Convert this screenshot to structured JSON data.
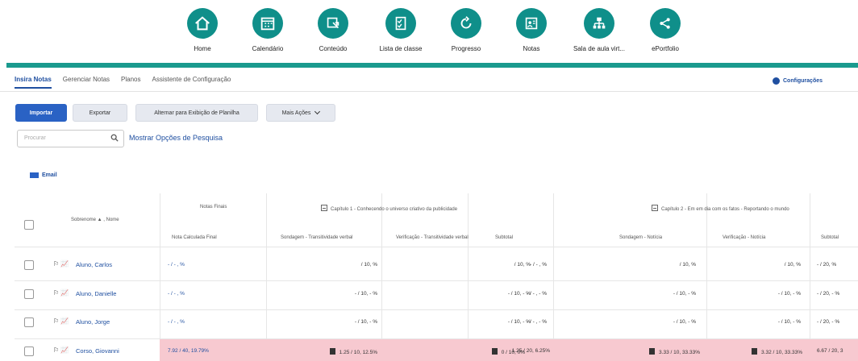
{
  "nav": [
    {
      "label": "Home",
      "icon": "home-icon"
    },
    {
      "label": "Calendário",
      "icon": "calendar-icon"
    },
    {
      "label": "Conteúdo",
      "icon": "content-icon"
    },
    {
      "label": "Lista de classe",
      "icon": "class-list-icon"
    },
    {
      "label": "Progresso",
      "icon": "progress-icon"
    },
    {
      "label": "Notas",
      "icon": "grades-icon"
    },
    {
      "label": "Sala de aula virt...",
      "icon": "virtual-classroom-icon"
    },
    {
      "label": "ePortfolio",
      "icon": "eportfolio-icon"
    }
  ],
  "tabs": [
    "Insira Notas",
    "Gerenciar Notas",
    "Planos",
    "Assistente de Configuração"
  ],
  "config_label": "Configurações",
  "toolbar": {
    "import": "Importar",
    "export": "Exportar",
    "toggle": "Alternar para Exibição de Planilha",
    "more": "Mais Ações"
  },
  "search": {
    "placeholder": "Procurar",
    "options": "Mostrar Opções de Pesquisa"
  },
  "email_label": "Email",
  "grid": {
    "col_name": "Sobrenome ▲ , Nome",
    "col_final": "Notas Finais",
    "col_final_sub": "Nota Calculada Final",
    "chapter1": "Capítulo 1 - Conhecendo o universo criativo da publicidade",
    "chapter2": "Capítulo 2 - Em em dia com os fatos - Reportando o mundo",
    "subcols": [
      "Sondagem - Transitividade verbal",
      "Verificação - Transitividade verbal",
      "Subtotal",
      "Sondagem - Notícia",
      "Verificação - Notícia",
      "Subtotal"
    ],
    "rows": [
      {
        "name": "Aluno, Carlos",
        "final": "- / - , % ",
        "c1": "/ 10, %",
        "c2": "/ 10, %",
        "c3": "- / - , %",
        "c4": "/ 10, %",
        "c5": "/ 10, %",
        "c6": "- / 20, %"
      },
      {
        "name": "Aluno, Danielle",
        "final": "- / - , % ",
        "c1": "- / 10, - %",
        "c2": "- / 10, - %",
        "c3": "- / - , - %",
        "c4": "- / 10, - %",
        "c5": "- / 10, - %",
        "c6": "- / 20, - %"
      },
      {
        "name": "Aluno, Jorge",
        "final": "- / - , % ",
        "c1": "- / 10, - %",
        "c2": "- / 10, - %",
        "c3": "- / - , - %",
        "c4": "- / 10, - %",
        "c5": "- / 10, - %",
        "c6": "- / 20, - %"
      },
      {
        "name": "Corso, Giovanni",
        "final": "7.92 / 40, 19.79%",
        "c1": "1.25 / 10, 12.5%",
        "c2": "0 / 10, 0%",
        "c3": "1.25 / 20, 6.25%",
        "c4": "3.33 / 10, 33.33%",
        "c5": "3.32 / 10, 33.33%",
        "c6": "6.67 / 20, 3"
      }
    ]
  },
  "colors": {
    "teal": "#1a9a8e",
    "brand_blue": "#2a62c4",
    "highlight_row": "#f7c9d0"
  }
}
